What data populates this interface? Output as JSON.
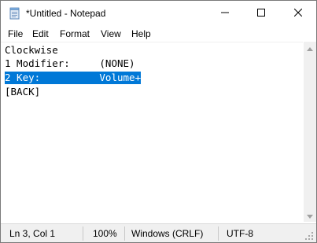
{
  "window": {
    "title": "*Untitled - Notepad",
    "icon": "notepad-icon"
  },
  "caption_buttons": {
    "minimize": "minimize-icon",
    "maximize": "maximize-icon",
    "close": "close-icon"
  },
  "menu": {
    "items": [
      {
        "label": "File"
      },
      {
        "label": "Edit"
      },
      {
        "label": "Format"
      },
      {
        "label": "View"
      },
      {
        "label": "Help"
      }
    ]
  },
  "editor": {
    "lines": [
      {
        "text": "Clockwise",
        "selected": false
      },
      {
        "text": "1 Modifier:     (NONE)",
        "selected": false
      },
      {
        "text": "2 Key:          Volume+",
        "selected": true
      },
      {
        "text": "[BACK]",
        "selected": false
      }
    ],
    "selection_color": "#0078d7"
  },
  "statusbar": {
    "position": "Ln 3, Col 1",
    "zoom": "100%",
    "line_ending": "Windows (CRLF)",
    "encoding": "UTF-8"
  }
}
